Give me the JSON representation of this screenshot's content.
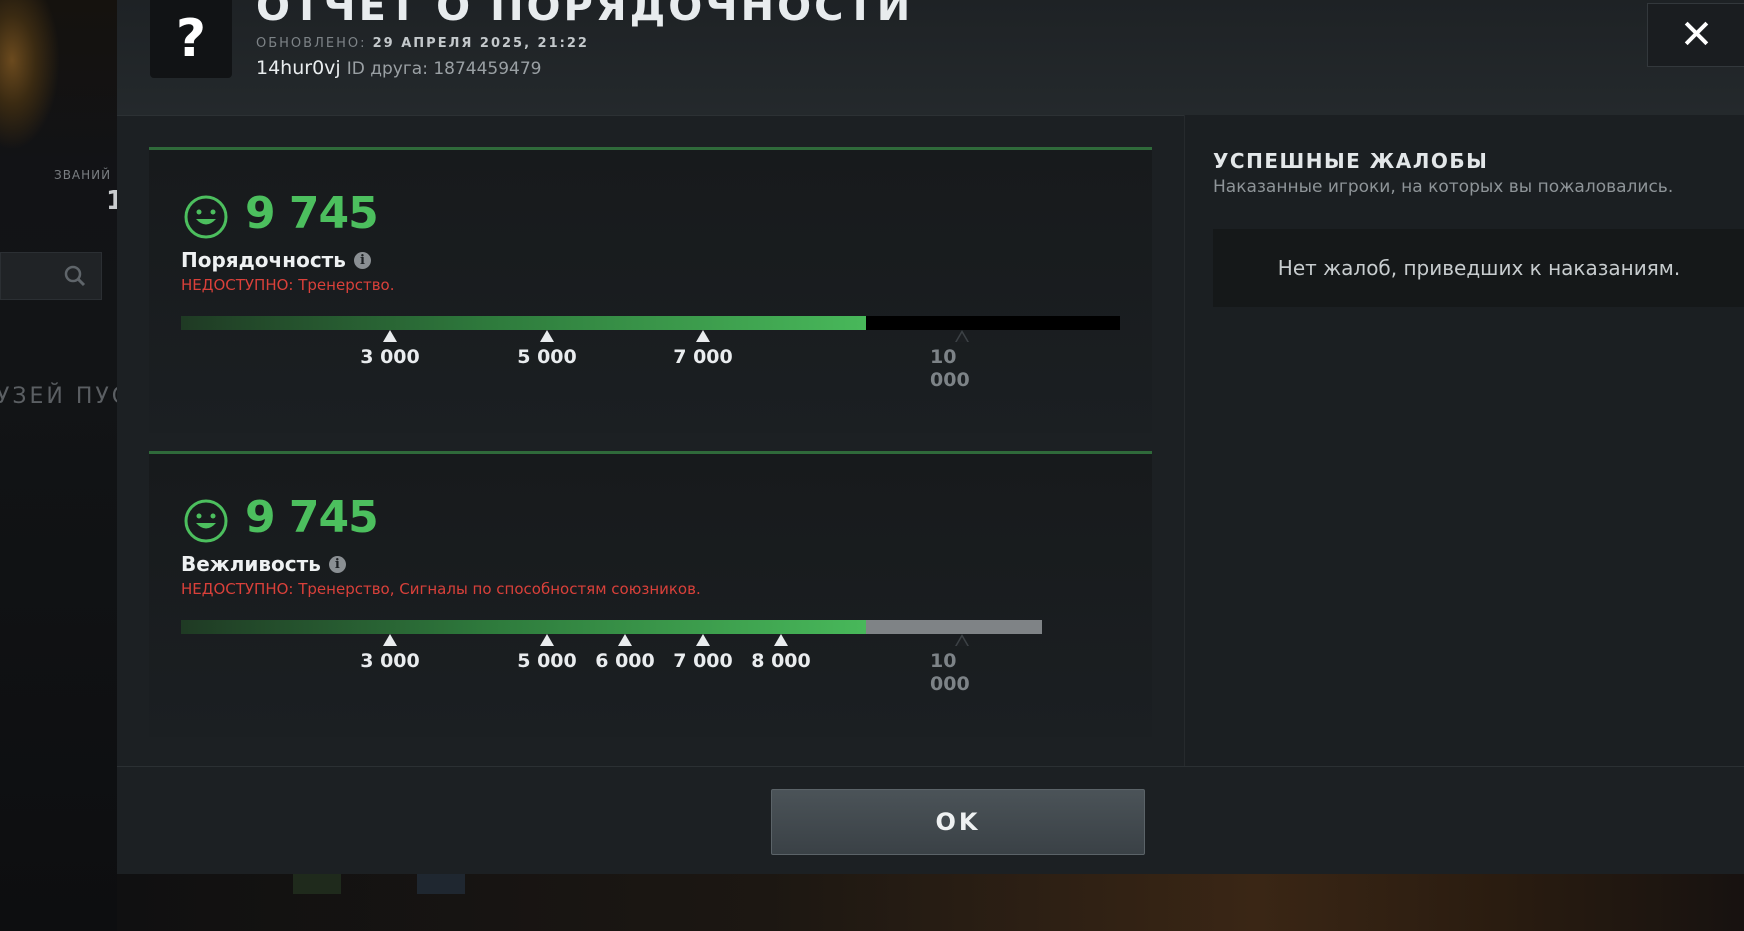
{
  "background": {
    "rank_label": "ЗВАНИЙ",
    "rank_value": "1",
    "friends_label": "УЗЕЙ ПУС"
  },
  "header": {
    "question_mark": "?",
    "title": "ОТЧЕТ О ПОРЯДОЧНОСТИ",
    "updated_label": "ОБНОВЛЕНО:",
    "updated_value": "29 АПРЕЛЯ 2025, 21:22",
    "username": "14hur0vj",
    "friend_id": "ID друга: 1874459479",
    "close_symbol": "✕"
  },
  "conduct": {
    "score": "9 745",
    "label": "Порядочность",
    "unavailable": "НЕДОСТУПНО:  Тренерство.",
    "progress": 0.9745,
    "ticks": [
      "3 000",
      "5 000",
      "7 000"
    ],
    "max_label_1": "10",
    "max_label_2": "000"
  },
  "behavior": {
    "score": "9 745",
    "label": "Вежливость",
    "unavailable": "НЕДОСТУПНО:  Тренерство, Сигналы по способностям союзников.",
    "progress": 0.9745,
    "ticks": [
      "3 000",
      "5 000",
      "6 000",
      "7 000",
      "8 000"
    ],
    "max_label_1": "10",
    "max_label_2": "000"
  },
  "reports": {
    "title": "УСПЕШНЫЕ ЖАЛОБЫ",
    "subtitle": "Наказанные игроки, на которых вы пожаловались.",
    "empty_text": "Нет жалоб, приведших к наказаниям."
  },
  "footer": {
    "ok_label": "OK"
  },
  "colors": {
    "score_green": "#4cbf5e",
    "unavailable_red": "#d9403a",
    "card_border": "#2f6a3a"
  }
}
